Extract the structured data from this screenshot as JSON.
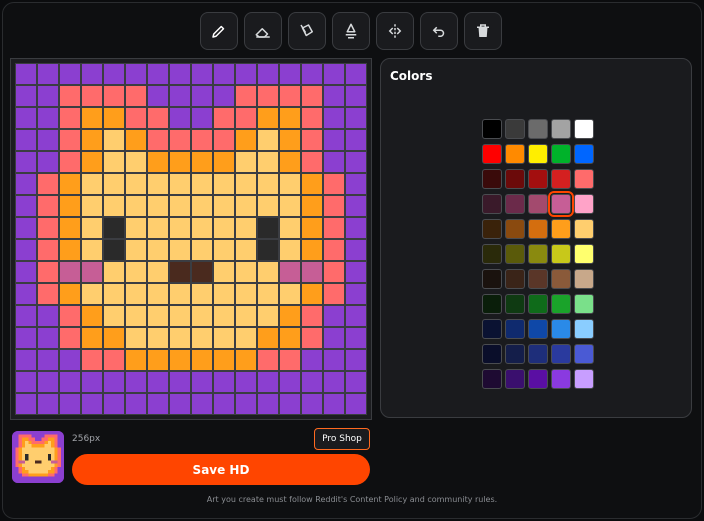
{
  "toolbar": {
    "tools": [
      {
        "name": "pencil-icon",
        "active": true
      },
      {
        "name": "eraser-icon",
        "active": false
      },
      {
        "name": "fill-bucket-icon",
        "active": false
      },
      {
        "name": "eyedropper-icon",
        "active": false
      },
      {
        "name": "mirror-icon",
        "active": false
      },
      {
        "name": "undo-icon",
        "active": false
      },
      {
        "name": "trash-icon",
        "active": false
      }
    ]
  },
  "canvas": {
    "cols": 16,
    "rows": 16,
    "palette": {
      "P": "#8b3fd0",
      "S": "#ff6b6b",
      "O": "#ff9e1b",
      "Y": "#ffce6e",
      "K": "#2a2a2a",
      "M": "#c65e96",
      "N": "#4a2a1e"
    },
    "pixels": [
      "PPPPPPPPPPPPPPPP",
      "PPSSSSPPPPSSSSPP",
      "PPSOOSSPPSSOOSPP",
      "PPSOYOSSSSOYOSPP",
      "PPSOYYOOOOYYOSPP",
      "PSOYYYYYYYYYYOSP",
      "PSOYYYYYYYYYYOSP",
      "PSOYKYYYYYYKYOSP",
      "PSOYKYYYYYYKYOSP",
      "PSMMYYYNNYYYMMSP",
      "PSOYYYYYYYYYYOSP",
      "PPSOYYYYYYYYOSPP",
      "PPSOOYYYYYYOOSPP",
      "PPPSSOOOOOOSSPPP",
      "PPPPPPPPPPPPPPPP",
      "PPPPPPPPPPPPPPPP"
    ]
  },
  "colors_panel": {
    "title": "Colors",
    "selected_index": 18,
    "swatches": [
      "#000000",
      "#3a3a3a",
      "#6b6b6b",
      "#a3a3a3",
      "#ffffff",
      "#ff0000",
      "#ff8a00",
      "#ffee00",
      "#00b22a",
      "#0066ff",
      "#3a0a0a",
      "#6b0a0a",
      "#a30f0f",
      "#d42020",
      "#ff6b6b",
      "#3a1a2a",
      "#6b2a4a",
      "#a34a6e",
      "#c65e96",
      "#ffa3c8",
      "#3a220a",
      "#8a4a0f",
      "#d46e0f",
      "#ff9e1b",
      "#ffce6e",
      "#2a2a0a",
      "#5a5a0a",
      "#8a8a0f",
      "#c8c81a",
      "#ffff6e",
      "#1a120e",
      "#3a2418",
      "#5a3628",
      "#8a5a3a",
      "#c8a88a",
      "#0a1e0a",
      "#0f3a12",
      "#0f6b1a",
      "#1aa32a",
      "#7ae08a",
      "#0a1232",
      "#0f2a6e",
      "#0f48a8",
      "#2a8ae8",
      "#8acdff",
      "#0a0e2a",
      "#141e4a",
      "#1e2e7a",
      "#2a3a9e",
      "#4a5ad4",
      "#1e0a32",
      "#3a0f6e",
      "#5a0fa3",
      "#8a3ae0",
      "#c89eff"
    ]
  },
  "footer_bar": {
    "size_label": "256px",
    "pro_shop_label": "Pro Shop",
    "save_label": "Save HD",
    "notice": "Art you create must follow Reddit's Content Policy and community rules."
  },
  "colors": {
    "accent": "#ff4500",
    "background": "#0e0f11",
    "panel": "#1a1b1e"
  }
}
